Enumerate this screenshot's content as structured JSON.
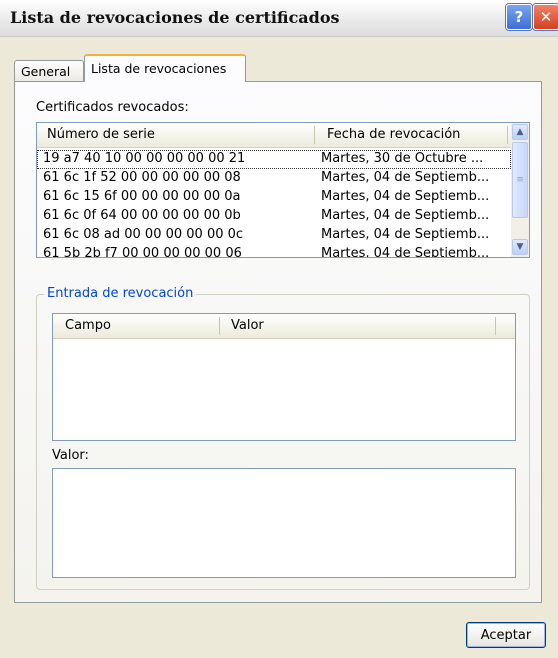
{
  "window": {
    "title": "Lista de revocaciones de certificados",
    "help_glyph": "?",
    "close_glyph": "✕"
  },
  "tabs": [
    "General",
    "Lista de revocaciones"
  ],
  "revoked_label": "Certificados revocados:",
  "revoked_list": {
    "columns": [
      "Número de serie",
      "Fecha de revocación"
    ],
    "rows": [
      {
        "serial": "19 a7 40 10 00 00 00 00 00 21",
        "date": "Martes, 30 de Octubre ..."
      },
      {
        "serial": "61 6c 1f 52 00 00 00 00 00 08",
        "date": "Martes, 04 de Septiemb..."
      },
      {
        "serial": "61 6c 15 6f 00 00 00 00 00 0a",
        "date": "Martes, 04 de Septiemb..."
      },
      {
        "serial": "61 6c 0f 64 00 00 00 00 00 0b",
        "date": "Martes, 04 de Septiemb..."
      },
      {
        "serial": "61 6c 08 ad 00 00 00 00 00 0c",
        "date": "Martes, 04 de Septiemb..."
      },
      {
        "serial": "61 5b 2b f7 00 00 00 00 00 06",
        "date": "Martes, 04 de Septiemb..."
      }
    ]
  },
  "entry_group": {
    "title": "Entrada de revocación",
    "columns": [
      "Campo",
      "Valor"
    ],
    "value_label": "Valor:"
  },
  "buttons": {
    "ok": "Aceptar"
  },
  "icons": {
    "scroll_up": "▲",
    "scroll_down": "▼",
    "thumb_grip": "≡"
  }
}
